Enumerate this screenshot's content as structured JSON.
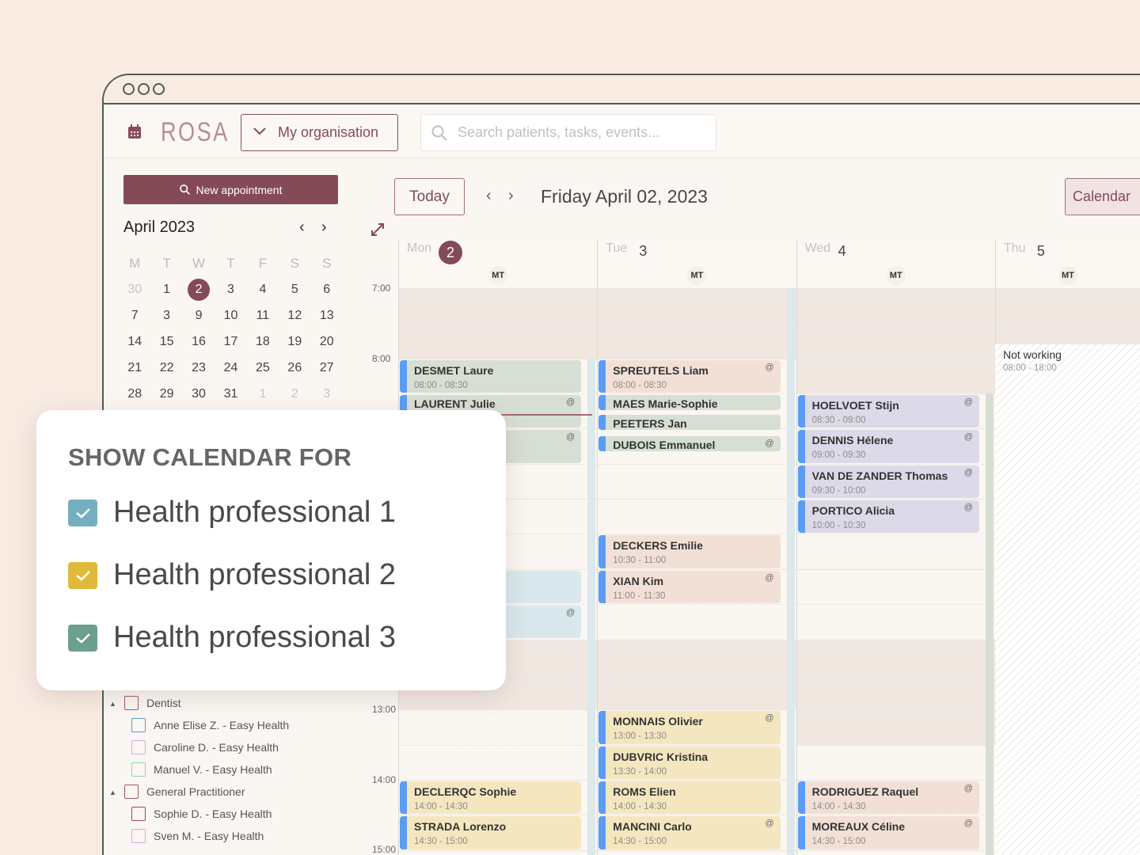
{
  "app": {
    "logo": "ROSA",
    "org_select": "My organisation",
    "search_placeholder": "Search patients, tasks, events..."
  },
  "sidebar": {
    "new_appointment": "New appointment",
    "month_title": "April 2023",
    "weekdays": [
      "M",
      "T",
      "W",
      "T",
      "F",
      "S",
      "S"
    ],
    "weeks": [
      [
        "30",
        "1",
        "2",
        "3",
        "4",
        "5",
        "6"
      ],
      [
        "7",
        "3",
        "9",
        "10",
        "11",
        "12",
        "13"
      ],
      [
        "14",
        "15",
        "16",
        "17",
        "18",
        "19",
        "20"
      ],
      [
        "21",
        "22",
        "23",
        "24",
        "25",
        "26",
        "27"
      ],
      [
        "28",
        "29",
        "30",
        "31",
        "1",
        "2",
        "3"
      ]
    ],
    "selected_day": "2",
    "tree": [
      {
        "label": "Dentist",
        "group": true,
        "color": "#9a5b68"
      },
      {
        "label": "Anne Elise Z. - Easy Health",
        "color": "#5e9bd0"
      },
      {
        "label": "Caroline D. - Easy Health",
        "color": "#d8a6e8"
      },
      {
        "label": "Manuel V. - Easy Health",
        "color": "#8fd4c0"
      },
      {
        "label": "General Practitioner",
        "group": true,
        "color": "#9a5b68"
      },
      {
        "label": "Sophie D. - Easy Health",
        "color": "#a8405e"
      },
      {
        "label": "Sven M. - Easy Health",
        "color": "#d8a6e8"
      }
    ]
  },
  "toolbar": {
    "today": "Today",
    "date_title": "Friday April 02, 2023",
    "calendar_button": "Calendar"
  },
  "hours": [
    "7:00",
    "8:00",
    "13:00",
    "14:00",
    "15:00"
  ],
  "days": [
    {
      "name": "Mon",
      "num": "2",
      "current": true,
      "badge": "MT",
      "events": [
        {
          "name": "DESMET Laure",
          "time": "08:00 - 08:30",
          "start": "08:00",
          "end": "08:30",
          "color": "#d7ded3",
          "at": false
        },
        {
          "name": "LAURENT Julie",
          "time": "",
          "start": "08:30",
          "end": "09:00",
          "color": "#d7ded3",
          "at": true
        },
        {
          "name": "",
          "time": "",
          "start": "09:00",
          "end": "09:30",
          "color": "#d7ded3",
          "at": true
        },
        {
          "name": "",
          "time": "",
          "start": "11:00",
          "end": "11:30",
          "color": "#d9e8ec",
          "at": false
        },
        {
          "name": "",
          "time": "",
          "start": "11:30",
          "end": "12:00",
          "color": "#d9e8ec",
          "at": true
        },
        {
          "name": "DECLERQC Sophie",
          "time": "14:00 - 14:30",
          "start": "14:00",
          "end": "14:30",
          "color": "#f4e6bf",
          "at": false
        },
        {
          "name": "STRADA Lorenzo",
          "time": "14:30 - 15:00",
          "start": "14:30",
          "end": "15:00",
          "color": "#f4e6bf",
          "at": false
        }
      ]
    },
    {
      "name": "Tue",
      "num": "3",
      "badge": "MT",
      "events": [
        {
          "name": "SPREUTELS Liam",
          "time": "08:00 - 08:30",
          "start": "08:00",
          "end": "08:30",
          "color": "#f2e0d6",
          "at": true
        },
        {
          "name": "MAES Marie-Sophie",
          "time": "",
          "start": "08:30",
          "end": "08:45",
          "color": "#d7ded3",
          "at": false
        },
        {
          "name": "PEETERS Jan",
          "time": "",
          "start": "08:47",
          "end": "09:02",
          "color": "#d7ded3",
          "at": false
        },
        {
          "name": "DUBOIS Emmanuel",
          "time": "",
          "start": "09:05",
          "end": "09:20",
          "color": "#d7ded3",
          "at": true
        },
        {
          "name": "DECKERS Emilie",
          "time": "10:30 - 11:00",
          "start": "10:30",
          "end": "11:00",
          "color": "#f2e0d6",
          "at": false
        },
        {
          "name": "XIAN Kim",
          "time": "11:00 - 11:30",
          "start": "11:00",
          "end": "11:30",
          "color": "#f2e0d6",
          "at": true
        },
        {
          "name": "MONNAIS Olivier",
          "time": "13:00 - 13:30",
          "start": "13:00",
          "end": "13:30",
          "color": "#f4e6bf",
          "at": true
        },
        {
          "name": "DUBVRIC Kristina",
          "time": "13:30 - 14:00",
          "start": "13:30",
          "end": "14:00",
          "color": "#f4e6bf",
          "at": false
        },
        {
          "name": "ROMS Elien",
          "time": "14:00 - 14:30",
          "start": "14:00",
          "end": "14:30",
          "color": "#f4e6bf",
          "at": false
        },
        {
          "name": "MANCINI Carlo",
          "time": "14:30 - 15:00",
          "start": "14:30",
          "end": "15:00",
          "color": "#f4e6bf",
          "at": true
        }
      ]
    },
    {
      "name": "Wed",
      "num": "4",
      "badge": "MT",
      "events": [
        {
          "name": "HOELVOET Stijn",
          "time": "08:30 - 09:00",
          "start": "08:30",
          "end": "09:00",
          "color": "#dcdae8",
          "at": true
        },
        {
          "name": "DENNIS Hélene",
          "time": "09:00 - 09:30",
          "start": "09:00",
          "end": "09:30",
          "color": "#dcdae8",
          "at": true
        },
        {
          "name": "VAN DE ZANDER Thomas",
          "time": "09:30 - 10:00",
          "start": "09:30",
          "end": "10:00",
          "color": "#dcdae8",
          "at": true
        },
        {
          "name": "PORTICO Alicia",
          "time": "10:00 - 10:30",
          "start": "10:00",
          "end": "10:30",
          "color": "#dcdae8",
          "at": true
        },
        {
          "name": "RODRIGUEZ Raquel",
          "time": "14:00 - 14:30",
          "start": "14:00",
          "end": "14:30",
          "color": "#f2e0d6",
          "at": true
        },
        {
          "name": "MOREAUX Céline",
          "time": "14:30 - 15:00",
          "start": "14:30",
          "end": "15:00",
          "color": "#f2e0d6",
          "at": true
        }
      ]
    },
    {
      "name": "Thu",
      "num": "5",
      "badge": "MT",
      "events": []
    }
  ],
  "not_working": {
    "label": "Not working",
    "time": "08:00 - 18:00"
  },
  "popup": {
    "title": "SHOW CALENDAR FOR",
    "items": [
      {
        "label": "Health professional 1",
        "color": "#74afc0",
        "checked": true
      },
      {
        "label": "Health professional 2",
        "color": "#e0b83a",
        "checked": true
      },
      {
        "label": "Health professional 3",
        "color": "#6c9f90",
        "checked": true
      }
    ]
  },
  "colors": {
    "accent": "#844a58",
    "event_bar": "#5b9cf5",
    "background": "#f8ebe2"
  }
}
